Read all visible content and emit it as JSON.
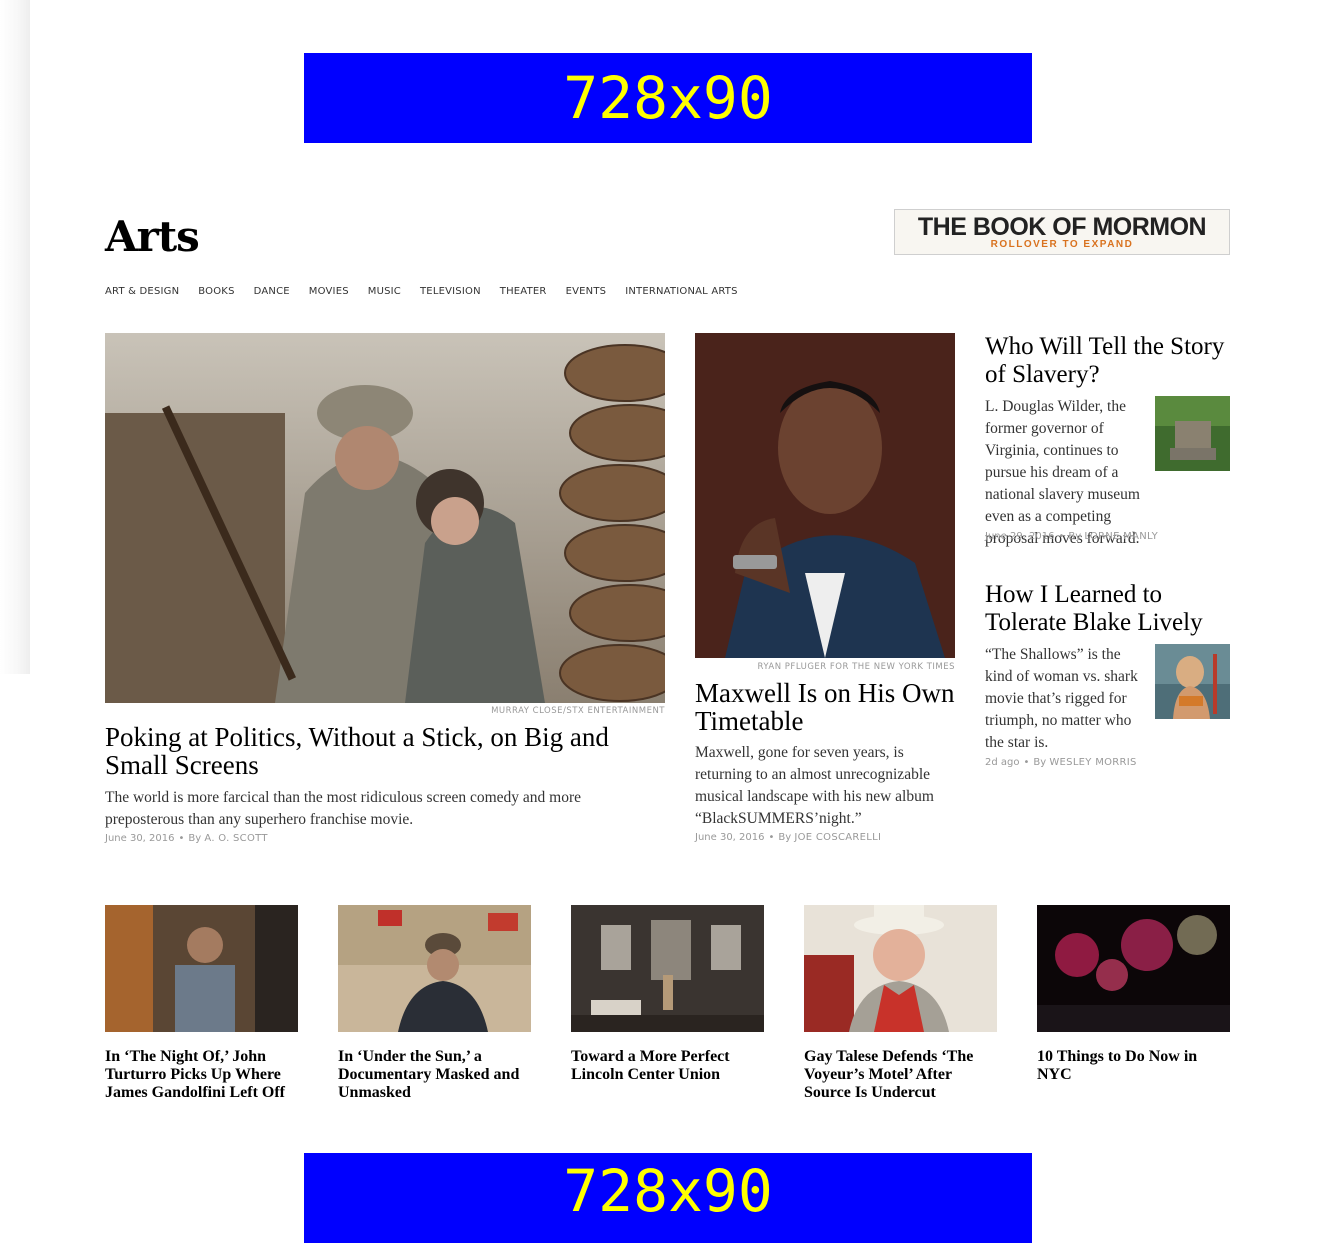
{
  "ads": {
    "top_label": "728x90",
    "bottom_label": "728x90"
  },
  "section": {
    "title": "Arts"
  },
  "promo": {
    "title": "THE BOOK OF MORMON",
    "subtitle": "ROLLOVER TO EXPAND"
  },
  "nav": {
    "items": [
      "ART & DESIGN",
      "BOOKS",
      "DANCE",
      "MOVIES",
      "MUSIC",
      "TELEVISION",
      "THEATER",
      "EVENTS",
      "INTERNATIONAL ARTS"
    ]
  },
  "lead": {
    "credit": "MURRAY CLOSE/STX ENTERTAINMENT",
    "headline": "Poking at Politics, Without a Stick, on Big and Small Screens",
    "summary": "The world is more farcical than the most ridiculous screen comedy and more preposterous than any superhero franchise movie.",
    "date": "June 30, 2016",
    "by": "By",
    "author": "A. O. SCOTT"
  },
  "second": {
    "credit": "RYAN PFLUGER FOR THE NEW YORK TIMES",
    "headline": "Maxwell Is on His Own Timetable",
    "summary": "Maxwell, gone for seven years, is returning to an almost unrecognizable musical landscape with his new album “BlackSUMMERS’night.”",
    "date": "June 30, 2016",
    "by": "By",
    "author": "JOE COSCARELLI"
  },
  "right_stories": [
    {
      "headline": "Who Will Tell the Story of Slavery?",
      "summary": "L. Douglas Wilder, the former governor of Virginia, continues to pursue his dream of a national slavery museum even as a competing proposal moves forward.",
      "date": "June 29, 2016",
      "by": "By",
      "author": "LORNE MANLY"
    },
    {
      "headline": "How I Learned to Tolerate Blake Lively",
      "summary": "“The Shallows” is the kind of woman vs. shark movie that’s rigged for triumph, no matter who the star is.",
      "date": "2d ago",
      "by": "By",
      "author": "WESLEY MORRIS"
    }
  ],
  "bottom_stories": [
    {
      "headline": "In ‘The Night Of,’ John Turturro Picks Up Where James Gandolfini Left Off"
    },
    {
      "headline": "In ‘Under the Sun,’ a Documentary Masked and Unmasked"
    },
    {
      "headline": "Toward a More Perfect Lincoln Center Union"
    },
    {
      "headline": "Gay Talese Defends ‘The Voyeur’s Motel’ After Source Is Undercut"
    },
    {
      "headline": "10 Things to Do Now in NYC"
    }
  ],
  "colors": {
    "ad_background": "#0000ff",
    "ad_text": "#ffff00",
    "promo_accent": "#d9721f",
    "meta_text": "#999999"
  }
}
